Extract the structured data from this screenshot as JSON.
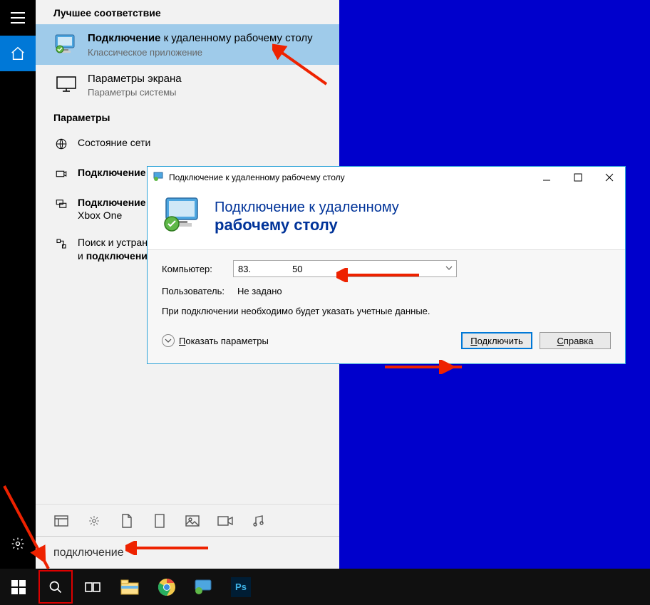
{
  "start": {
    "section_best_match": "Лучшее соответствие",
    "best_match": {
      "title_bold": "Подключение",
      "title_rest": " к удаленному рабочему столу",
      "subtitle": "Классическое приложение"
    },
    "display_params": {
      "title": "Параметры экрана",
      "subtitle": "Параметры системы"
    },
    "section_params": "Параметры",
    "items": [
      {
        "text_full": "Состояние сети"
      },
      {
        "text_bold": "Подключение"
      },
      {
        "text_bold": "Подключение",
        "text_rest_sub": "Xbox One"
      },
      {
        "text_pre": "Поиск и устранен",
        "text_bold": "подключени",
        "text_prefix_line2": "и "
      }
    ],
    "search_value": "подключение"
  },
  "rdp": {
    "titlebar": "Подключение к удаленному рабочему столу",
    "header_line1": "Подключение к удаленному",
    "header_line2": "рабочему столу",
    "computer_label": "Компьютер:",
    "computer_value_pre": "83.",
    "computer_value_post": "50",
    "user_label": "Пользователь:",
    "user_value": "Не задано",
    "note": "При подключении необходимо будет указать учетные данные.",
    "show_options": "Показать параметры",
    "connect_btn": "Подключить",
    "help_btn": "Справка"
  }
}
